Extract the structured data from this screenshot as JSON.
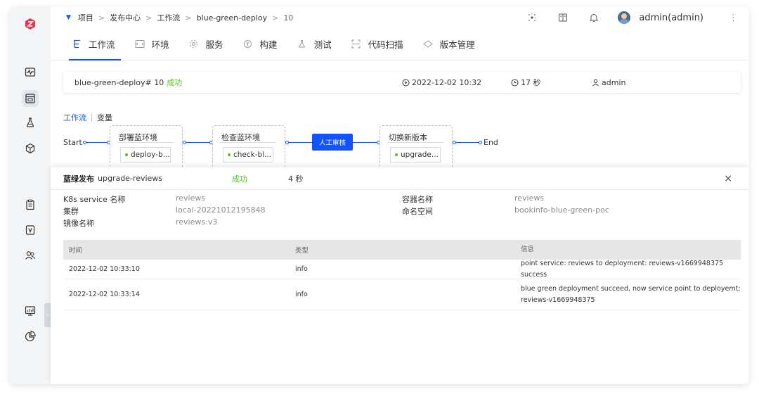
{
  "breadcrumb": {
    "items": [
      "项目",
      "发布中心",
      "工作流",
      "blue-green-deploy",
      "10"
    ]
  },
  "user": {
    "name": "admin(admin)"
  },
  "tabs": [
    {
      "label": "工作流",
      "icon": "workflow-icon",
      "active": true
    },
    {
      "label": "环境",
      "icon": "environment-icon"
    },
    {
      "label": "服务",
      "icon": "service-icon"
    },
    {
      "label": "构建",
      "icon": "build-icon"
    },
    {
      "label": "测试",
      "icon": "test-icon"
    },
    {
      "label": "代码扫描",
      "icon": "scan-icon"
    },
    {
      "label": "版本管理",
      "icon": "version-icon"
    }
  ],
  "run": {
    "name": "blue-green-deploy# 10",
    "status": "成功",
    "time": "2022-12-02 10:32",
    "duration": "17 秒",
    "creator": "admin"
  },
  "subtabs": {
    "workflow": "工作流",
    "variables": "变量"
  },
  "flow": {
    "start": "Start",
    "end": "End",
    "stages": [
      {
        "title": "部署蓝环境",
        "job": "deploy-b..."
      },
      {
        "title": "检查蓝环境",
        "job": "check-bl..."
      },
      {
        "title": "人工审核"
      },
      {
        "title": "切换新版本",
        "job": "upgrade..."
      }
    ]
  },
  "panel": {
    "type": "蓝绿发布",
    "name": "upgrade-reviews",
    "status": "成功",
    "duration": "4 秒",
    "close": "×",
    "fields": {
      "k8s_service_label": "K8s service 名称",
      "k8s_service": "reviews",
      "cluster_label": "集群",
      "cluster": "local-20221012195848",
      "image_label": "镜像名称",
      "image": "reviews:v3",
      "container_label": "容器名称",
      "container": "reviews",
      "namespace_label": "命名空间",
      "namespace": "bookinfo-blue-green-poc"
    },
    "table": {
      "headers": [
        "时间",
        "类型",
        "信息"
      ],
      "rows": [
        {
          "time": "2022-12-02 10:33:10",
          "type": "info",
          "info": "point service: reviews to deployment: reviews-v1669948375 success"
        },
        {
          "time": "2022-12-02 10:33:14",
          "type": "info",
          "info": "blue green deployment succeed, now service point to deployemt: reviews-v1669948375"
        }
      ]
    }
  },
  "colors": {
    "accent": "#1352ff",
    "success": "#52c41a",
    "logo": "#e8344e"
  }
}
